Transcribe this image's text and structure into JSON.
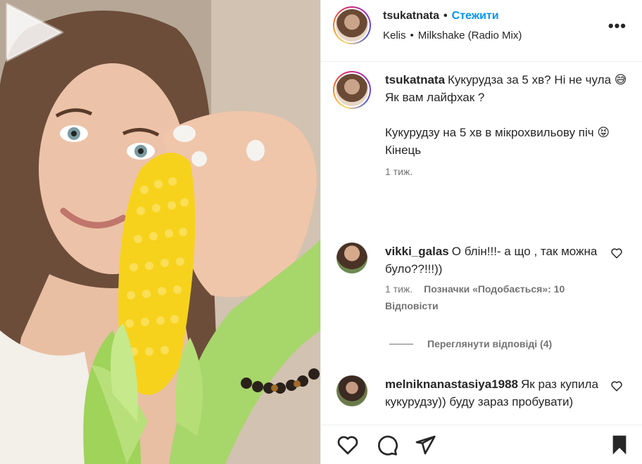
{
  "post": {
    "username": "tsukatnata",
    "separator": "•",
    "follow_label": "Стежити",
    "audio_artist": "Kelis",
    "audio_track": "Milkshake (Radio Mix)",
    "more_icon": "more-horizontal-icon"
  },
  "caption": {
    "username": "tsukatnata",
    "text": "Кукурудза за 5 хв? Ні не чула 😅\nЯк вам лайфхак ?\n\nКукурудзу на 5 хв в мікрохвильову піч 😝\nКінець",
    "time": "1 тиж."
  },
  "comments": [
    {
      "username": "vikki_galas",
      "text": "О блін!!!- а що , так можна було??!!!))",
      "time": "1 тиж.",
      "likes": "Позначки «Подобається»: 10",
      "reply_label": "Відповісти",
      "view_replies": "Переглянути відповіді (4)"
    },
    {
      "username": "melniknanastasiya1988",
      "text": "Як раз купила кукурудзу)) буду зараз пробувати)"
    }
  ],
  "actions": {
    "like": "heart-icon",
    "comment": "comment-icon",
    "share": "send-icon",
    "save": "bookmark-icon"
  },
  "colors": {
    "accent": "#0095f6",
    "secondary_text": "#737373",
    "corn": "#f7d21c",
    "husk": "#9fd35a"
  }
}
